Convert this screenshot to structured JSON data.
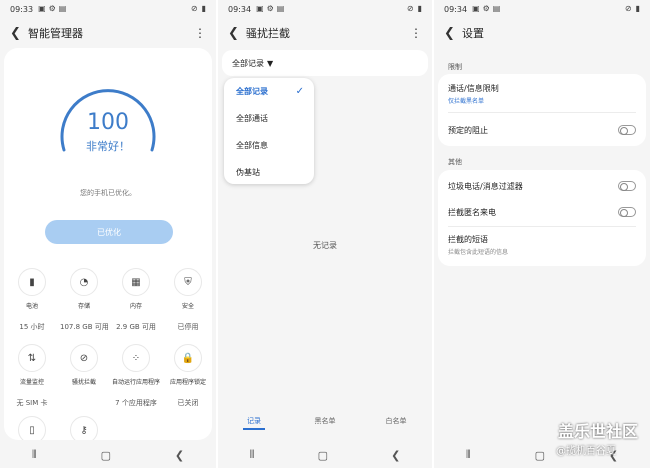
{
  "panel1": {
    "status_time": "09:33",
    "title": "智能管理器",
    "score": "100",
    "score_level": "非常好！",
    "score_fraction": 1.0,
    "description": "您的手机已优化。",
    "optimize_button": "已优化",
    "items": [
      {
        "icon": "battery-icon",
        "glyph": "▮",
        "label": "电池",
        "value": "15 小时"
      },
      {
        "icon": "storage-icon",
        "glyph": "◔",
        "label": "存储",
        "value": "107.8 GB 可用"
      },
      {
        "icon": "memory-icon",
        "glyph": "▦",
        "label": "内存",
        "value": "2.9 GB 可用"
      },
      {
        "icon": "security-icon",
        "glyph": "⛨",
        "label": "安全",
        "value": "已停用"
      },
      {
        "icon": "data-usage-icon",
        "glyph": "⇅",
        "label": "流量监控",
        "value": "无 SIM 卡"
      },
      {
        "icon": "block-icon",
        "glyph": "⊘",
        "label": "骚扰拦截",
        "value": ""
      },
      {
        "icon": "auto-run-icon",
        "glyph": "⁘",
        "label": "自动运行应用程序",
        "value": "7 个应用程序"
      },
      {
        "icon": "app-lock-icon",
        "glyph": "🔒",
        "label": "应用程序锁定",
        "value": "已关闭"
      },
      {
        "icon": "sd-card-icon",
        "glyph": "▯",
        "label": "",
        "value": ""
      },
      {
        "icon": "key-icon",
        "glyph": "⚷",
        "label": "",
        "value": ""
      }
    ]
  },
  "panel2": {
    "status_time": "09:34",
    "title": "骚扰拦截",
    "filter_label": "全部记录",
    "menu_items": [
      "全部记录",
      "全部通话",
      "全部信息",
      "伪基站"
    ],
    "selected_index": 0,
    "empty_text": "无记录",
    "tabs": [
      "记录",
      "黑名单",
      "白名单"
    ]
  },
  "panel3": {
    "status_time": "09:34",
    "title": "设置",
    "section_limit": "限制",
    "row_call_limit": "通话/信息限制",
    "row_call_limit_sub": "仅拦截黑名单",
    "row_scheduled_block": "预定的阻止",
    "section_other": "其他",
    "row_spam_filter": "垃圾电话/消息过滤器",
    "row_block_anonymous": "拦截匿名来电",
    "row_blocked_sms": "拦截的短语",
    "row_blocked_sms_sub": "拦截包含此短语的信息"
  },
  "watermark": {
    "line1": "盖乐世社区",
    "line2": "@揽机百谷夏"
  },
  "colors": {
    "accent": "#3d7cc9",
    "button_disabled": "#a9cdf2",
    "link_blue": "#2b6fcf"
  }
}
